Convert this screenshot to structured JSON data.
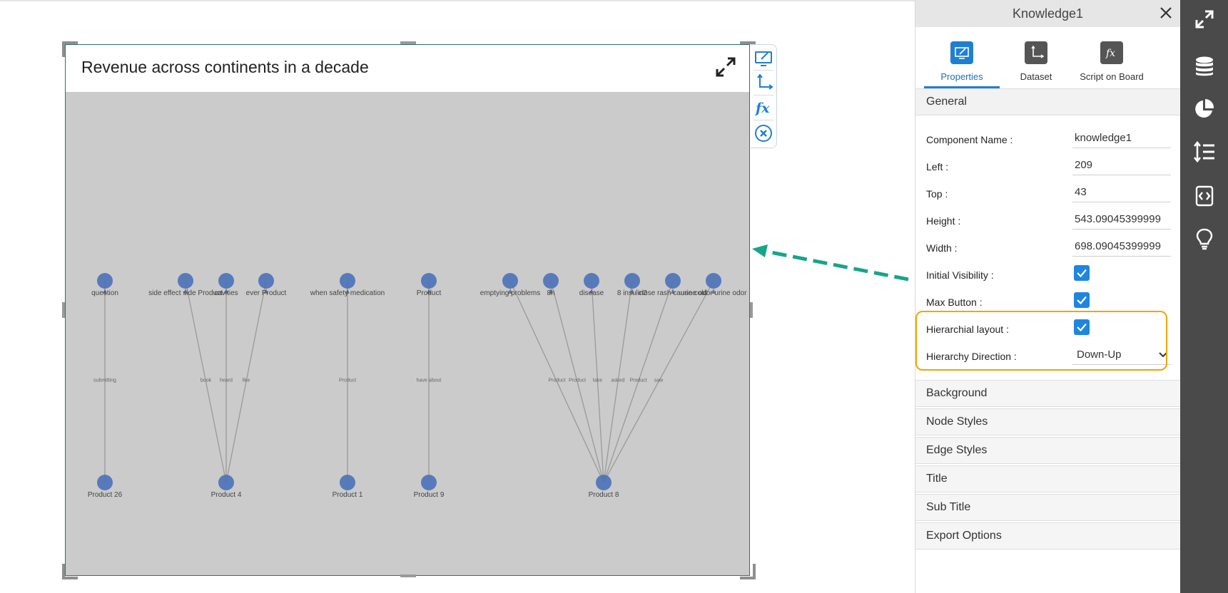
{
  "widget": {
    "title": "Revenue across continents in a decade",
    "graph": {
      "layout": "hierarchical",
      "direction": "Down-Up",
      "top_nodes": [
        {
          "label": "question"
        },
        {
          "label": "side effect side Product"
        },
        {
          "label": "cavities"
        },
        {
          "label": "ever Product"
        },
        {
          "label": "when safety medication"
        },
        {
          "label": "Product"
        },
        {
          "label": "emptying problems"
        },
        {
          "label": "8h"
        },
        {
          "label": "disease"
        },
        {
          "label": "8 insulin2"
        },
        {
          "label": "close rash cause cold"
        },
        {
          "label": "urine odor urine odor"
        }
      ],
      "bottom_nodes": [
        {
          "label": "Product 26"
        },
        {
          "label": "Product 4"
        },
        {
          "label": "Product 1"
        },
        {
          "label": "Product 9"
        },
        {
          "label": "Product 8"
        }
      ],
      "edges": [
        {
          "from": 0,
          "to": 0,
          "label": "submitting"
        },
        {
          "from": 1,
          "to": 1,
          "label": "book"
        },
        {
          "from": 2,
          "to": 1,
          "label": "heard"
        },
        {
          "from": 3,
          "to": 1,
          "label": "like"
        },
        {
          "from": 4,
          "to": 2,
          "label": "Product"
        },
        {
          "from": 5,
          "to": 3,
          "label": "have about"
        },
        {
          "from": 6,
          "to": 4,
          "label": "Product"
        },
        {
          "from": 7,
          "to": 4,
          "label": "Product"
        },
        {
          "from": 8,
          "to": 4,
          "label": "take"
        },
        {
          "from": 9,
          "to": 4,
          "label": "asked"
        },
        {
          "from": 10,
          "to": 4,
          "label": "Product"
        },
        {
          "from": 11,
          "to": 4,
          "label": "saw"
        }
      ]
    }
  },
  "colors": {
    "node": "#4a72b8",
    "edge": "#9a9a9a",
    "canvas": "#cbcbcb",
    "accent": "#1f86e0",
    "highlight": "#f0a500",
    "arrow": "#17a589"
  },
  "panel": {
    "title": "Knowledge1",
    "tabs": [
      {
        "label": "Properties",
        "icon": "monitor-edit-icon",
        "active": true
      },
      {
        "label": "Dataset",
        "icon": "axis-icon",
        "active": false
      },
      {
        "label": "Script on Board",
        "icon": "fx-icon",
        "active": false
      }
    ],
    "general": {
      "section_label": "General",
      "component_name_label": "Component Name :",
      "component_name_value": "knowledge1",
      "left_label": "Left :",
      "left_value": "209",
      "top_label": "Top :",
      "top_value": "43",
      "height_label": "Height :",
      "height_value": "543.09045399999",
      "width_label": "Width :",
      "width_value": "698.09045399999",
      "initial_visibility_label": "Initial Visibility :",
      "initial_visibility_checked": true,
      "max_button_label": "Max Button :",
      "max_button_checked": true,
      "hierarchial_layout_label": "Hierarchial layout :",
      "hierarchial_layout_checked": true,
      "hierarchy_direction_label": "Hierarchy Direction :",
      "hierarchy_direction_value": "Down-Up"
    },
    "sections": [
      "Background",
      "Node Styles",
      "Edge Styles",
      "Title",
      "Sub Title",
      "Export Options"
    ]
  },
  "sidebar": {
    "icons": [
      "expand-icon",
      "database-icon",
      "pie-chart-icon",
      "line-height-icon",
      "code-script-icon",
      "lightbulb-icon"
    ]
  }
}
